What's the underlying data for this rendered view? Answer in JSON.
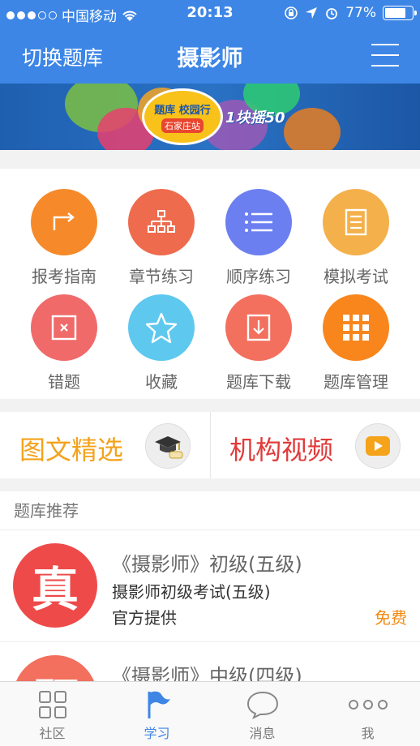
{
  "status_bar": {
    "carrier": "中国移动",
    "time": "20:13",
    "battery": "77%",
    "battery_level": 0.77
  },
  "header": {
    "left_button": "切换题库",
    "title": "摄影师",
    "menu_icon": "hamburger-menu-icon"
  },
  "banner": {
    "title": "题库 校园行",
    "subtitle": "石家庄站",
    "slogan": "1块摇50"
  },
  "grid": [
    {
      "label": "报考指南",
      "icon": "arrow-turn-icon",
      "color": "#f68a2a"
    },
    {
      "label": "章节练习",
      "icon": "hierarchy-icon",
      "color": "#ee6b4d"
    },
    {
      "label": "顺序练习",
      "icon": "list-icon",
      "color": "#6c7ff0"
    },
    {
      "label": "模拟考试",
      "icon": "document-icon",
      "color": "#f4b04a"
    },
    {
      "label": "错题",
      "icon": "wrong-box-icon",
      "color": "#f06a6a"
    },
    {
      "label": "收藏",
      "icon": "star-icon",
      "color": "#5ec8ef"
    },
    {
      "label": "题库下载",
      "icon": "download-icon",
      "color": "#f36f5e"
    },
    {
      "label": "题库管理",
      "icon": "grid-icon",
      "color": "#f8861d"
    }
  ],
  "features": [
    {
      "label": "图文精选",
      "color": "#f3a21b",
      "icon": "graduation-cap-icon"
    },
    {
      "label": "机构视频",
      "color": "#e23a3a",
      "icon": "video-play-icon"
    }
  ],
  "recommend": {
    "section_title": "题库推荐",
    "items": [
      {
        "badge": "真",
        "badge_color": "#ee4a4a",
        "title": "《摄影师》初级(五级)",
        "subtitle": "摄影师初级考试(五级)",
        "provider": "官方提供",
        "price": "免费"
      },
      {
        "badge": "题",
        "badge_color": "#f36f5e",
        "title": "《摄影师》中级(四级)",
        "subtitle": "",
        "provider": "",
        "price": ""
      }
    ]
  },
  "tabbar": [
    {
      "label": "社区",
      "icon": "grid-four-icon",
      "active": false
    },
    {
      "label": "学习",
      "icon": "flag-icon",
      "active": true
    },
    {
      "label": "消息",
      "icon": "chat-bubble-icon",
      "active": false
    },
    {
      "label": "我",
      "icon": "more-dots-icon",
      "active": false
    }
  ]
}
